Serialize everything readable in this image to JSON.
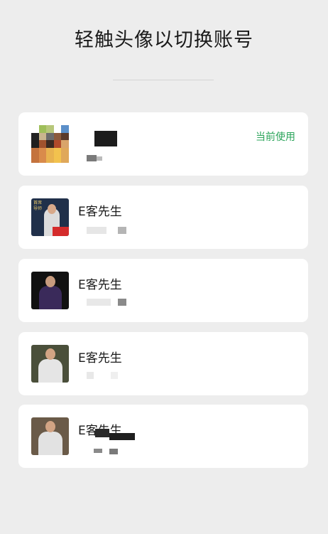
{
  "header": {
    "title": "轻触头像以切换账号"
  },
  "accounts": [
    {
      "name": "",
      "current_label": "当前使用"
    },
    {
      "name": "E客先生",
      "avatar_text": "首席 导师"
    },
    {
      "name": "E客先生"
    },
    {
      "name": "E客先生"
    },
    {
      "name": "E客先生"
    }
  ],
  "colors": {
    "accent": "#2aa45a",
    "background": "#ededed",
    "card": "#ffffff"
  }
}
